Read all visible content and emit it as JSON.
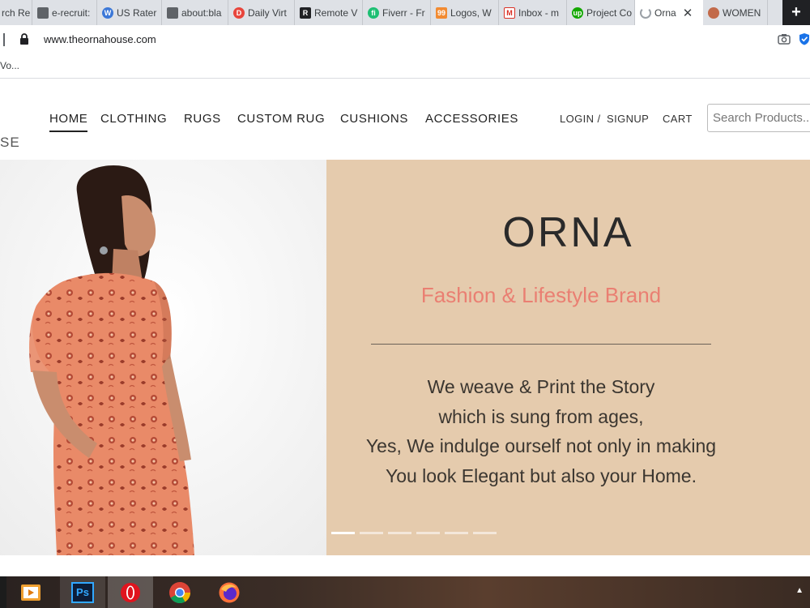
{
  "browser": {
    "tabs": [
      {
        "title": "rch Re",
        "fav_color": "#4285f4"
      },
      {
        "title": "e-recruit:",
        "fav_color": "#5f6368"
      },
      {
        "title": "US Rater",
        "fav_color": "#3c78d8"
      },
      {
        "title": "about:bla",
        "fav_color": "#5f6368"
      },
      {
        "title": "Daily Virt",
        "fav_color": "#e8453c"
      },
      {
        "title": "Remote V",
        "fav_color": "#202124"
      },
      {
        "title": "Fiverr - Fr",
        "fav_color": "#1dbf73"
      },
      {
        "title": "Logos, W",
        "fav_color": "#f28b32"
      },
      {
        "title": "Inbox - m",
        "fav_color": "#d93025"
      },
      {
        "title": "Project Co",
        "fav_color": "#14a800"
      },
      {
        "title": "Orna",
        "fav_color": "#9aa0a6"
      },
      {
        "title": "WOMEN",
        "fav_color": "#c26a4a"
      }
    ],
    "url": "www.theornahouse.com",
    "bookmark_fragment": "Vo..."
  },
  "header": {
    "logo_fragment": "SE",
    "nav": [
      "HOME",
      "CLOTHING",
      "RUGS",
      "CUSTOM RUG",
      "CUSHIONS",
      "ACCESSORIES"
    ],
    "login": "LOGIN /",
    "signup": "SIGNUP",
    "cart": "CART",
    "search_placeholder": "Search Products..."
  },
  "hero": {
    "brand": "ORNA",
    "tagline": "Fashion & Lifestyle Brand",
    "story": [
      "We weave & Print the Story",
      "which is sung from ages,",
      "Yes, We indulge ourself not only in making",
      "You look Elegant but also your Home."
    ],
    "slide_count": 6,
    "active_slide": 1,
    "panel_color": "#e5cbad",
    "tagline_color": "#ea7f72"
  },
  "taskbar": {
    "apps": [
      "media-player-icon",
      "photoshop-icon",
      "opera-icon",
      "chrome-icon",
      "firefox-icon"
    ],
    "photoshop_label": "Ps"
  }
}
